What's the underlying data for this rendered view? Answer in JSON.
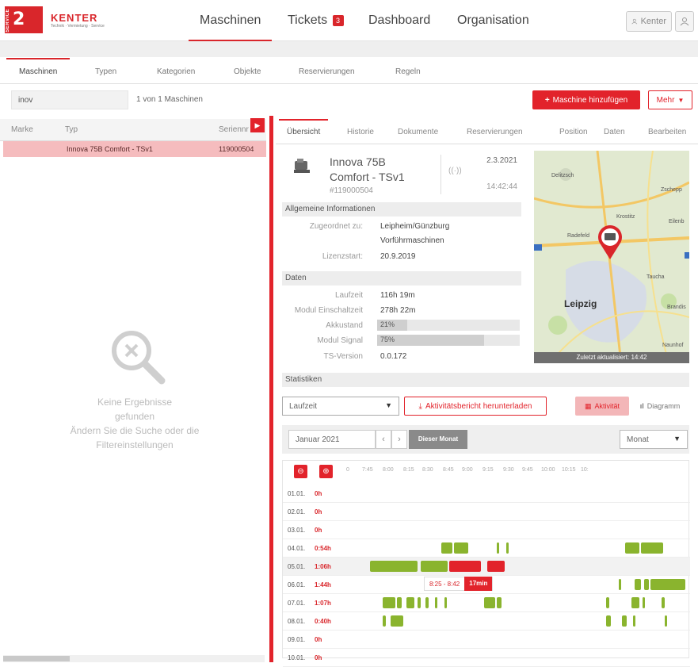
{
  "brand": {
    "badge": "2",
    "service": "SERVICE",
    "name": "KENTER",
    "tagline": "Technik · Vermietung · Service"
  },
  "nav": {
    "items": [
      {
        "label": "Maschinen",
        "active": true
      },
      {
        "label": "Tickets",
        "badge": "3"
      },
      {
        "label": "Dashboard"
      },
      {
        "label": "Organisation"
      }
    ]
  },
  "user": {
    "name": "Kenter"
  },
  "subtabs": [
    "Maschinen",
    "Typen",
    "Kategorien",
    "Objekte",
    "Reservierungen",
    "Regeln"
  ],
  "search": {
    "value": "inov",
    "count": "1 von 1 Maschinen"
  },
  "buttons": {
    "add": "Maschine hinzufügen",
    "more": "Mehr"
  },
  "list": {
    "headers": [
      "Marke",
      "Typ",
      "Seriennr"
    ],
    "rows": [
      {
        "marke": "",
        "typ": "Innova 75B Comfort - TSv1",
        "serial": "119000504"
      }
    ],
    "empty_title": "Keine Ergebnisse gefunden",
    "empty_hint": "Ändern Sie die Suche oder die Filtereinstellungen"
  },
  "detail": {
    "tabs": [
      "Übersicht",
      "Historie",
      "Dokumente",
      "Reservierungen",
      "Position",
      "Daten",
      "Bearbeiten"
    ],
    "title": "Innova 75B Comfort - TSv1",
    "id": "#119000504",
    "date": "2.3.2021",
    "time": "14:42:44",
    "general_title": "Allgemeine Informationen",
    "assigned_label": "Zugeordnet zu:",
    "assigned_value_1": "Leipheim/Günzburg",
    "assigned_value_2": "Vorführmaschinen",
    "license_label": "Lizenzstart:",
    "license_value": "20.9.2019",
    "data_title": "Daten",
    "runtime_label": "Laufzeit",
    "runtime_value": "116h 19m",
    "module_label": "Modul Einschaltzeit",
    "module_value": "278h 22m",
    "battery_label": "Akkustand",
    "battery_value": "21%",
    "battery_pct": 21,
    "signal_label": "Modul Signal",
    "signal_value": "75%",
    "signal_pct": 75,
    "ts_label": "TS-Version",
    "ts_value": "0.0.172"
  },
  "map": {
    "updated": "Zuletzt aktualisiert: 14:42",
    "labels": [
      "Leipzig",
      "Taucha",
      "Zschepp",
      "Eilenb",
      "Brandis",
      "Naunhof",
      "Radefeld",
      "Krostitz",
      "Delitzsch"
    ]
  },
  "stats": {
    "title": "Statistiken",
    "metric": "Laufzeit",
    "report_button": "Aktivitätsbericht herunterladen",
    "activity_tab": "Aktivität",
    "chart_tab": "Diagramm",
    "month": "Januar 2021",
    "this_month": "Dieser Monat",
    "range": "Monat"
  },
  "timeline": {
    "hours": [
      "0",
      "7:45",
      "8:00",
      "8:15",
      "8:30",
      "8:45",
      "9:00",
      "9:15",
      "9:30",
      "9:45",
      "10:00",
      "10:15",
      "10:"
    ],
    "rows": [
      {
        "day": "01.01.",
        "hours": "0h"
      },
      {
        "day": "02.01.",
        "hours": "0h"
      },
      {
        "day": "03.01.",
        "hours": "0h"
      },
      {
        "day": "04.01.",
        "hours": "0:54h"
      },
      {
        "day": "05.01.",
        "hours": "1:06h"
      },
      {
        "day": "06.01.",
        "hours": "1:44h"
      },
      {
        "day": "07.01.",
        "hours": "1:07h"
      },
      {
        "day": "08.01.",
        "hours": "0:40h"
      },
      {
        "day": "09.01.",
        "hours": "0h"
      },
      {
        "day": "10.01.",
        "hours": "0h"
      }
    ],
    "tooltip_range": "8:25 - 8:42",
    "tooltip_duration": "17min",
    "colors": {
      "active": "#8ab42e",
      "highlight": "#e2232b"
    }
  }
}
